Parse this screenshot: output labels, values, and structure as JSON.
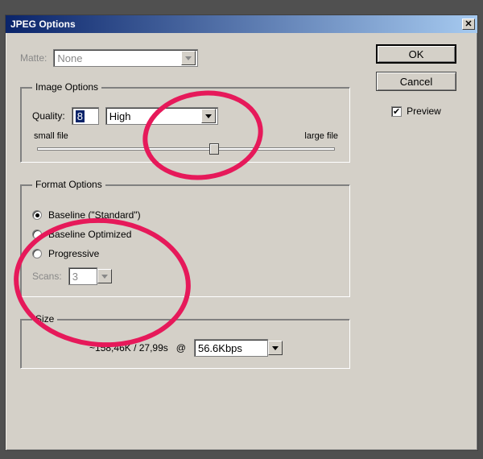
{
  "dialog": {
    "title": "JPEG Options",
    "matte_label": "Matte:",
    "matte_value": "None"
  },
  "image_options": {
    "legend": "Image Options",
    "quality_label": "Quality:",
    "quality_value": "8",
    "quality_preset": "High",
    "slider_min_label": "small file",
    "slider_max_label": "large file"
  },
  "format_options": {
    "legend": "Format Options",
    "opt1": "Baseline (\"Standard\")",
    "opt2": "Baseline Optimized",
    "opt3": "Progressive",
    "scans_label": "Scans:",
    "scans_value": "3"
  },
  "size": {
    "legend": "Size",
    "estimate": "~158,46K / 27,99s",
    "at": "@",
    "rate": "56.6Kbps"
  },
  "buttons": {
    "ok": "OK",
    "cancel": "Cancel",
    "preview": "Preview"
  }
}
